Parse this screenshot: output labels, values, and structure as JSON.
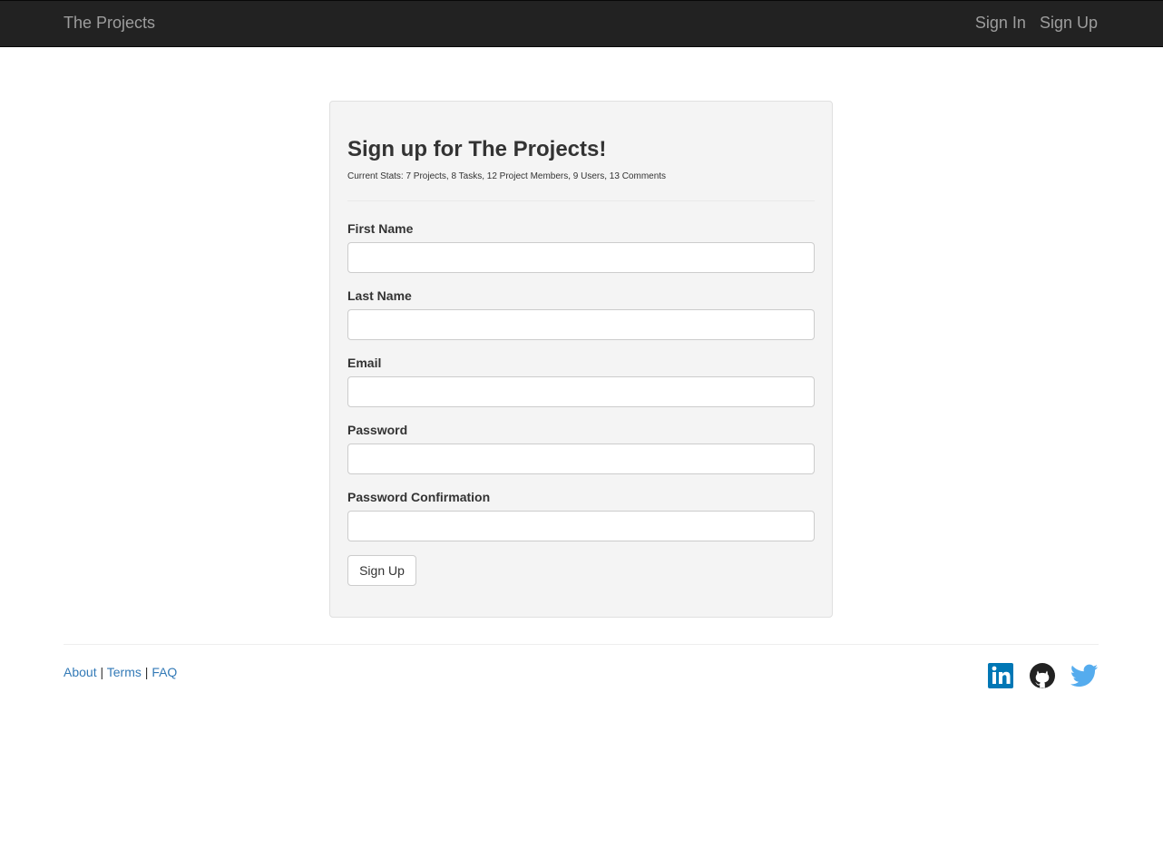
{
  "navbar": {
    "brand": "The Projects",
    "links": [
      "Sign In",
      "Sign Up"
    ]
  },
  "form": {
    "title": "Sign up for The Projects!",
    "stats": "Current Stats: 7 Projects, 8 Tasks, 12 Project Members, 9 Users, 13 Comments",
    "fields": [
      {
        "label": "First Name",
        "value": ""
      },
      {
        "label": "Last Name",
        "value": ""
      },
      {
        "label": "Email",
        "value": ""
      },
      {
        "label": "Password",
        "value": ""
      },
      {
        "label": "Password Confirmation",
        "value": ""
      }
    ],
    "submit_label": "Sign Up"
  },
  "footer": {
    "links": [
      "About",
      "Terms",
      "FAQ"
    ],
    "separator": "|",
    "social_icons": [
      "linkedin-icon",
      "github-icon",
      "twitter-icon"
    ]
  },
  "colors": {
    "navbar_bg": "#222222",
    "link": "#337ab7",
    "linkedin": "#0077b5",
    "github": "#222222",
    "twitter": "#55acee"
  }
}
